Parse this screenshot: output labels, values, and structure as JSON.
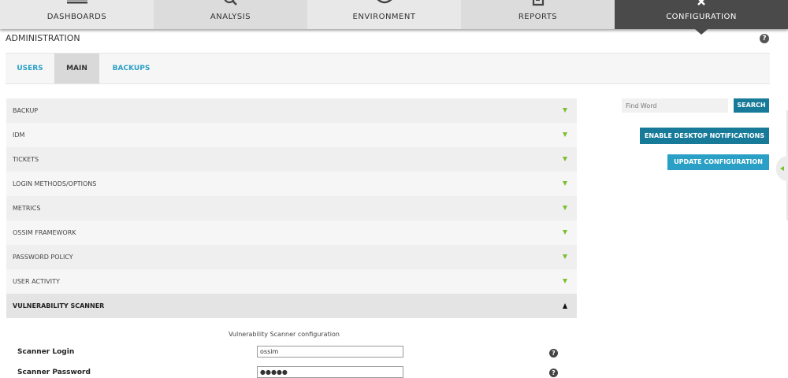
{
  "nav": {
    "items": [
      {
        "label": "DASHBOARDS",
        "icon": "dashboards-icon"
      },
      {
        "label": "ANALYSIS",
        "icon": "analysis-icon"
      },
      {
        "label": "ENVIRONMENT",
        "icon": "environment-icon"
      },
      {
        "label": "REPORTS",
        "icon": "reports-icon"
      },
      {
        "label": "CONFIGURATION",
        "icon": "configuration-icon"
      }
    ],
    "active": "CONFIGURATION"
  },
  "header": {
    "title": "ADMINISTRATION",
    "help": "?"
  },
  "tabs": [
    {
      "label": "USERS"
    },
    {
      "label": "MAIN"
    },
    {
      "label": "BACKUPS"
    }
  ],
  "accordion": [
    {
      "label": "BACKUP"
    },
    {
      "label": "IDM"
    },
    {
      "label": "TICKETS"
    },
    {
      "label": "LOGIN METHODS/OPTIONS"
    },
    {
      "label": "METRICS"
    },
    {
      "label": "OSSIM FRAMEWORK"
    },
    {
      "label": "PASSWORD POLICY"
    },
    {
      "label": "USER ACTIVITY"
    },
    {
      "label": "VULNERABILITY SCANNER"
    }
  ],
  "right_panel": {
    "search_placeholder": "Find Word",
    "search_button": "SEARCH",
    "notify_button": "ENABLE DESKTOP NOTIFICATIONS",
    "update_button": "UPDATE CONFIGURATION"
  },
  "vuln_scanner": {
    "heading": "Vulnerability Scanner configuration",
    "login_label": "Scanner Login",
    "login_value": "ossim",
    "password_label": "Scanner Password",
    "password_value": "●●●●●",
    "help": "?"
  },
  "colors": {
    "accent": "#2aa0c6",
    "accent_dark": "#177a99",
    "nav_active": "#4a4a4a",
    "arrow_green": "#7cbf2e"
  }
}
